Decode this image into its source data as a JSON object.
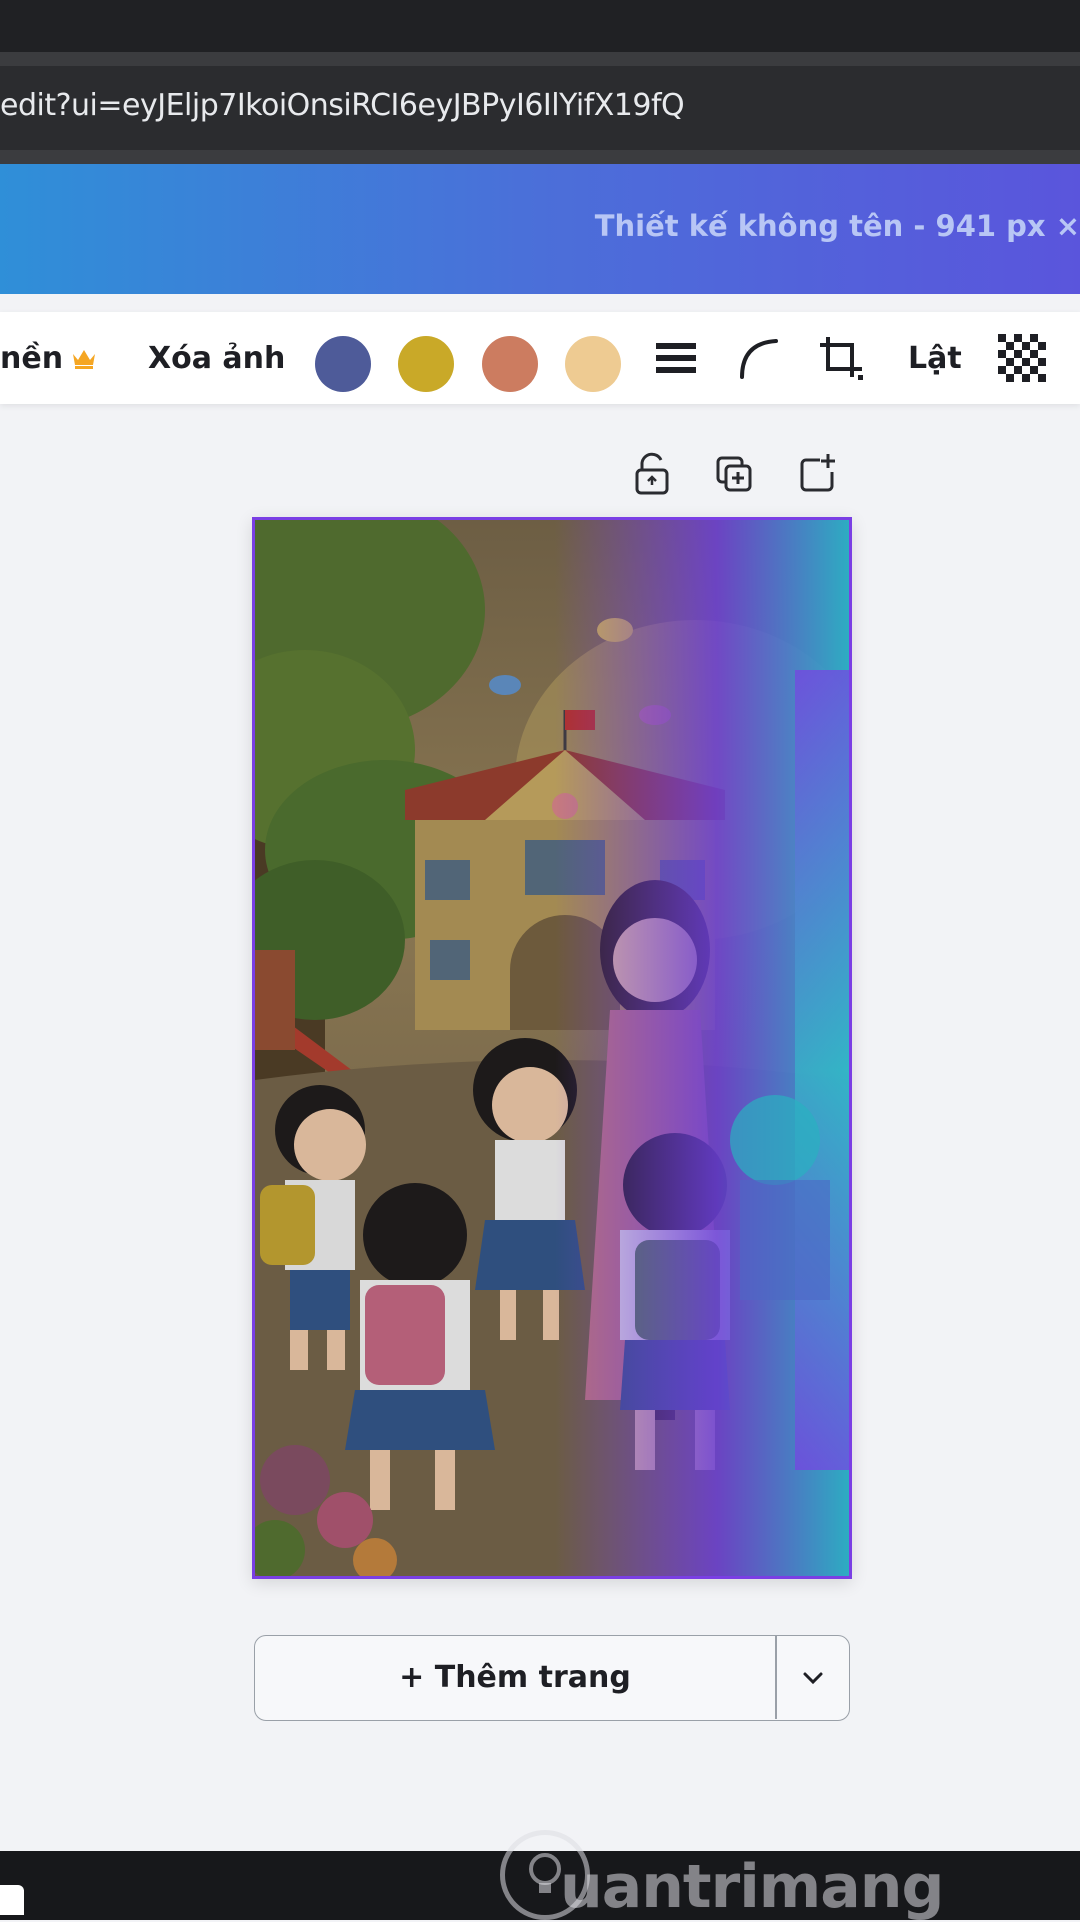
{
  "browser": {
    "url": "edit?ui=eyJEljp7IkoiOnsiRCI6eyJBPyI6IlYifX19fQ"
  },
  "header": {
    "doc_title": "Thiết kế không tên - 941 px ×"
  },
  "toolbar": {
    "partial_label": "nền",
    "crown_icon": "crown-icon",
    "remove_bg_label": "Xóa ảnh",
    "swatches": [
      "#4e5b99",
      "#c9a928",
      "#cc7c60",
      "#eecb92"
    ],
    "flip_label": "Lật"
  },
  "page_actions": {
    "lock_icon": "lock-icon",
    "duplicate_icon": "duplicate-icon",
    "add_icon": "add-page-icon"
  },
  "canvas": {
    "image_description_icon": "illustration-image"
  },
  "add_page": {
    "label": "+ Thêm trang"
  },
  "watermark": {
    "text": "uantrimang"
  }
}
